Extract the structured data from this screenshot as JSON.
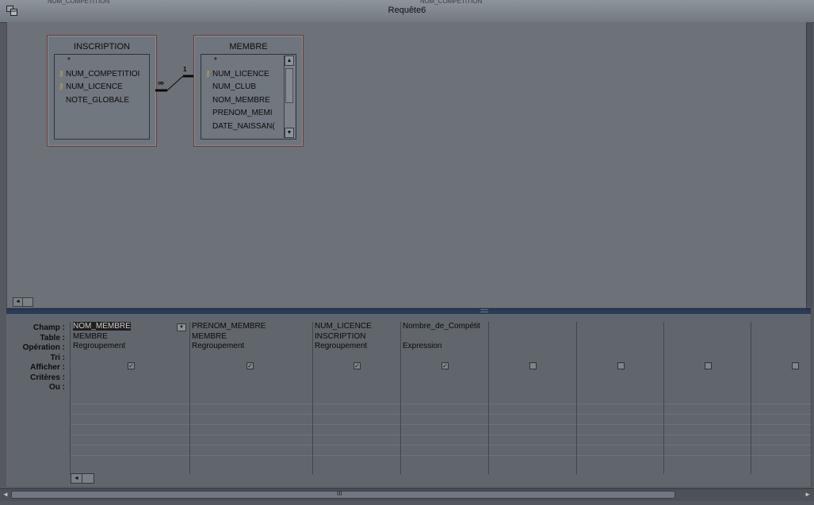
{
  "window": {
    "title": "Requête6",
    "ghost_left": "NUM_COMPETITION",
    "ghost_right": "NUM_COMPETITION"
  },
  "tables": [
    {
      "name": "INSCRIPTION",
      "fields": [
        {
          "label": "*",
          "key": false
        },
        {
          "label": "NUM_COMPETITIOI",
          "key": true
        },
        {
          "label": "NUM_LICENCE",
          "key": true
        },
        {
          "label": "NOTE_GLOBALE",
          "key": false
        }
      ]
    },
    {
      "name": "MEMBRE",
      "fields": [
        {
          "label": "*",
          "key": false
        },
        {
          "label": "NUM_LICENCE",
          "key": true
        },
        {
          "label": "NUM_CLUB",
          "key": false
        },
        {
          "label": "NOM_MEMBRE",
          "key": false
        },
        {
          "label": "PRENOM_MEMI",
          "key": false
        },
        {
          "label": "DATE_NAISSAN(",
          "key": false
        }
      ]
    }
  ],
  "relation": {
    "one_label": "1",
    "many_label": "∞"
  },
  "grid": {
    "row_labels": [
      "Champ :",
      "Table :",
      "Opération :",
      "Tri :",
      "Afficher :",
      "Critères :",
      "Ou :"
    ],
    "columns": [
      {
        "champ": "NOM_MEMBRE",
        "table": "MEMBRE",
        "operation": "Regroupement",
        "tri": "",
        "afficher": true
      },
      {
        "champ": "PRENOM_MEMBRE",
        "table": "MEMBRE",
        "operation": "Regroupement",
        "tri": "",
        "afficher": true
      },
      {
        "champ": "NUM_LICENCE",
        "table": "INSCRIPTION",
        "operation": "Regroupement",
        "tri": "",
        "afficher": true
      },
      {
        "champ": "Nombre_de_Compétit",
        "table": "",
        "operation": "Expression",
        "tri": "",
        "afficher": true
      },
      {
        "champ": "",
        "table": "",
        "operation": "",
        "tri": "",
        "afficher": false
      },
      {
        "champ": "",
        "table": "",
        "operation": "",
        "tri": "",
        "afficher": false
      },
      {
        "champ": "",
        "table": "",
        "operation": "",
        "tri": "",
        "afficher": false
      },
      {
        "champ": "",
        "table": "",
        "operation": "",
        "tri": "",
        "afficher": false
      }
    ]
  },
  "scrollbar": {
    "thumb_glyph": "III"
  },
  "icons": {
    "window": "query-window-icon",
    "check": "✓",
    "left_arrow": "◄",
    "right_arrow": "►",
    "up_arrow": "▲",
    "down_arrow": "▼"
  }
}
